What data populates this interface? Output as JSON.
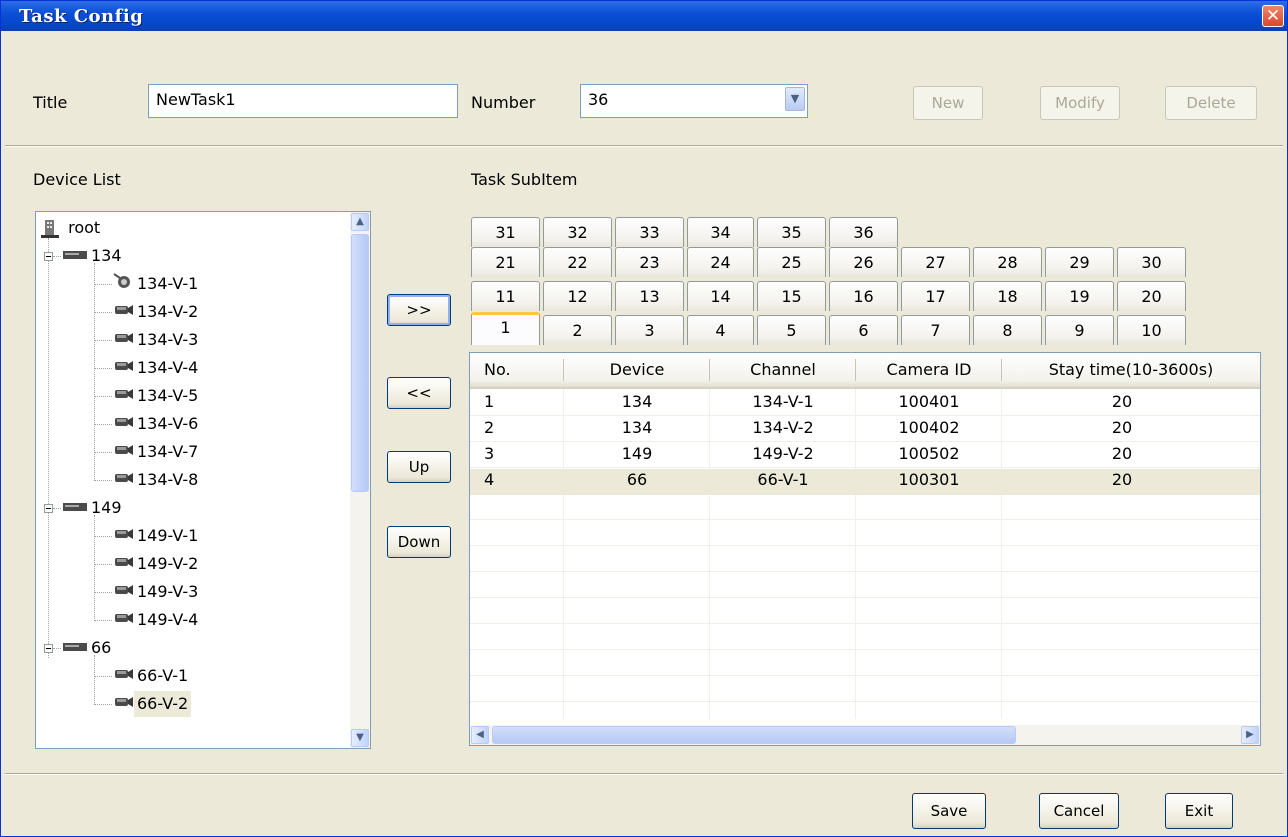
{
  "window": {
    "title": "Task Config",
    "close": "✕"
  },
  "top": {
    "title_label": "Title",
    "title_value": "NewTask1",
    "number_label": "Number",
    "number_value": "36",
    "new_button": "New",
    "modify_button": "Modify",
    "delete_button": "Delete"
  },
  "device_list": {
    "label": "Device List",
    "root": "root",
    "devices": [
      {
        "name": "134",
        "channels": [
          "134-V-1",
          "134-V-2",
          "134-V-3",
          "134-V-4",
          "134-V-5",
          "134-V-6",
          "134-V-7",
          "134-V-8"
        ]
      },
      {
        "name": "149",
        "channels": [
          "149-V-1",
          "149-V-2",
          "149-V-3",
          "149-V-4"
        ]
      },
      {
        "name": "66",
        "channels": [
          "66-V-1",
          "66-V-2"
        ]
      }
    ],
    "selected": "66-V-2"
  },
  "middle_buttons": {
    "add": ">>",
    "remove": "<<",
    "up": "Up",
    "down": "Down"
  },
  "task_subitem": {
    "label": "Task SubItem",
    "tab_rows": [
      [
        "31",
        "32",
        "33",
        "34",
        "35",
        "36"
      ],
      [
        "21",
        "22",
        "23",
        "24",
        "25",
        "26",
        "27",
        "28",
        "29",
        "30"
      ],
      [
        "11",
        "12",
        "13",
        "14",
        "15",
        "16",
        "17",
        "18",
        "19",
        "20"
      ],
      [
        "1",
        "2",
        "3",
        "4",
        "5",
        "6",
        "7",
        "8",
        "9",
        "10"
      ]
    ],
    "active_tab": "1",
    "columns": [
      "No.",
      "Device",
      "Channel",
      "Camera ID",
      "Stay time(10-3600s)"
    ],
    "rows": [
      [
        "1",
        "134",
        "134-V-1",
        "100401",
        "20"
      ],
      [
        "2",
        "134",
        "134-V-2",
        "100402",
        "20"
      ],
      [
        "3",
        "149",
        "149-V-2",
        "100502",
        "20"
      ],
      [
        "4",
        "66",
        "66-V-1",
        "100301",
        "20"
      ]
    ],
    "selected_row": 3
  },
  "footer": {
    "save": "Save",
    "cancel": "Cancel",
    "exit": "Exit"
  },
  "colors": {
    "titlebar": "#0a50d6",
    "face": "#ece9d8",
    "border": "#7f9db9",
    "active_tab": "#ffc83c"
  }
}
